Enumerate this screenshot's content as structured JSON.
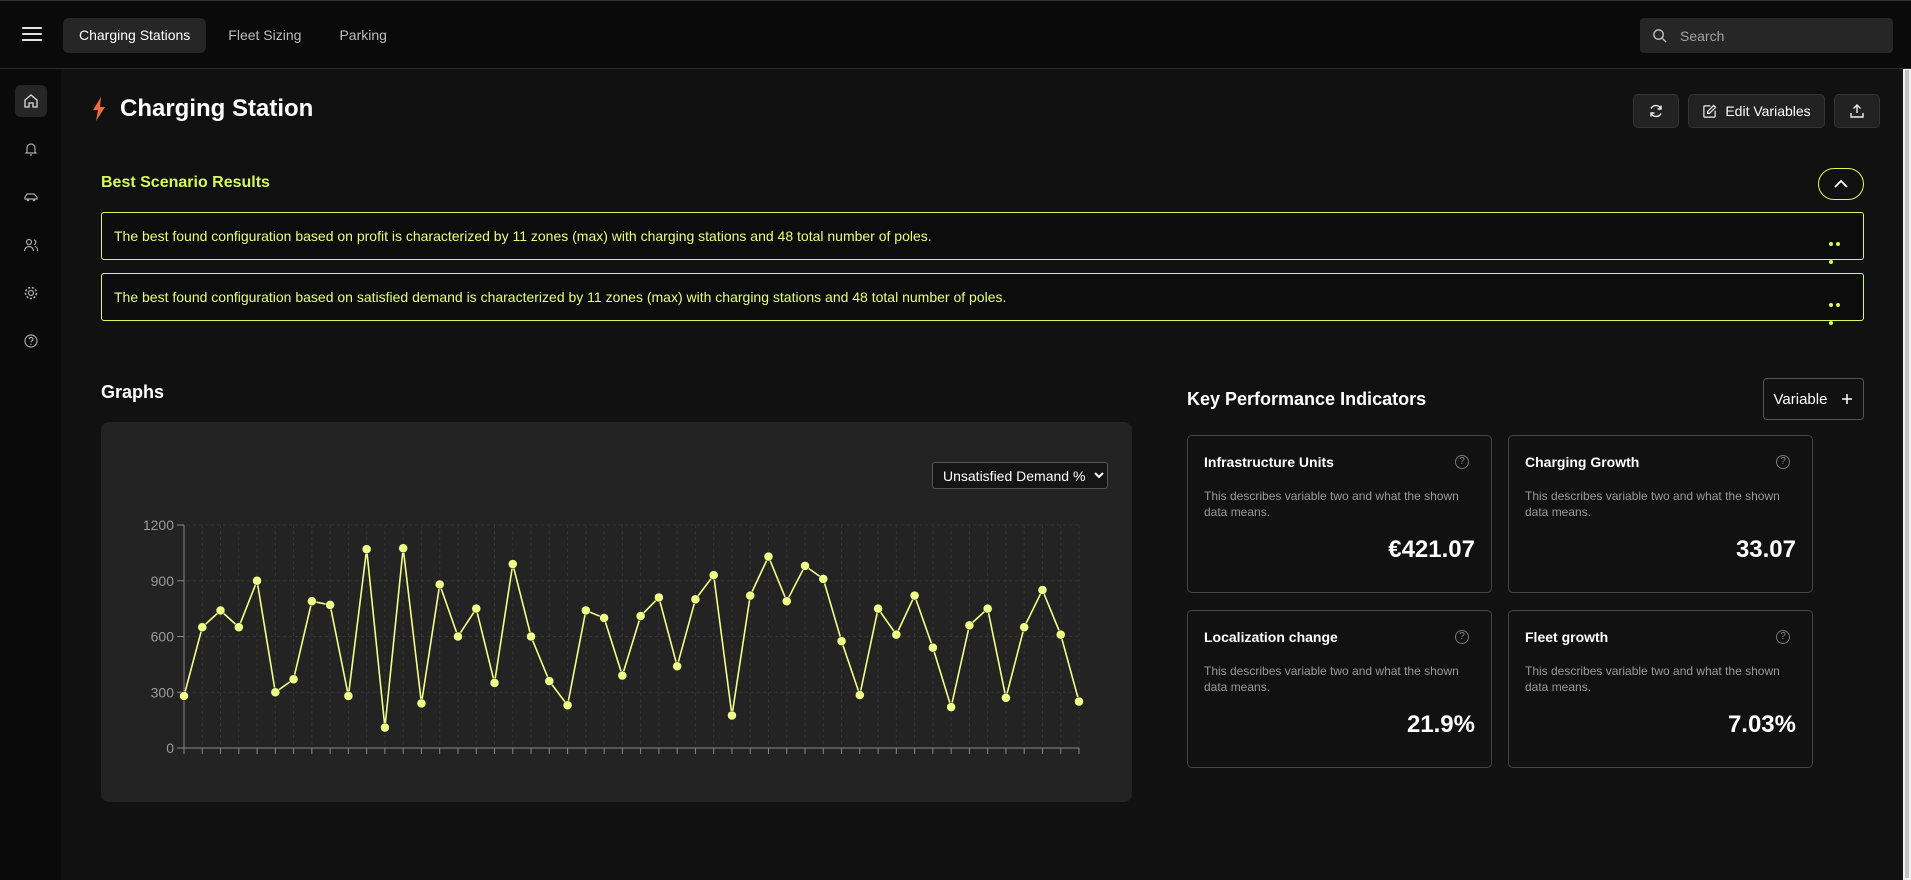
{
  "header": {
    "tabs": [
      {
        "label": "Charging Stations"
      },
      {
        "label": "Fleet Sizing"
      },
      {
        "label": "Parking"
      }
    ],
    "search_placeholder": "Search"
  },
  "sidebar": {
    "items": [
      "home-icon",
      "bell-icon",
      "car-icon",
      "users-icon",
      "gear-icon",
      "help-icon"
    ]
  },
  "page": {
    "title": "Charging Station",
    "edit_variables_label": "Edit Variables"
  },
  "best_results": {
    "title": "Best Scenario Results",
    "items": [
      "The best found configuration based on profit is characterized by 11 zones (max) with charging stations and 48 total number of poles.",
      "The best found configuration based on satisfied demand is characterized by 11 zones (max) with charging stations and 48 total number of poles."
    ]
  },
  "graphs": {
    "title": "Graphs",
    "selected_metric": "Unsatisfied Demand %"
  },
  "kpi": {
    "title": "Key Performance Indicators",
    "variable_button": "Variable",
    "cards": [
      {
        "name": "Infrastructure Units",
        "description": "This describes variable two and what the shown data means.",
        "value": "€421.07"
      },
      {
        "name": "Charging Growth",
        "description": "This describes variable two and what the shown data means.",
        "value": "33.07"
      },
      {
        "name": "Localization change",
        "description": "This describes variable two and what the shown data means.",
        "value": "21.9%"
      },
      {
        "name": "Fleet growth",
        "description": "This describes variable two and what the shown data means.",
        "value": "7.03%"
      }
    ]
  },
  "colors": {
    "accent": "#d4fa5e",
    "line": "#f0ff8a"
  },
  "chart_data": {
    "type": "line",
    "title": "",
    "xlabel": "",
    "ylabel": "",
    "ylim": [
      0,
      1200
    ],
    "yticks": [
      0,
      300,
      600,
      900,
      1200
    ],
    "grid": true,
    "values": [
      280,
      650,
      740,
      650,
      900,
      300,
      370,
      790,
      770,
      280,
      1070,
      110,
      1075,
      240,
      880,
      600,
      750,
      350,
      990,
      600,
      360,
      230,
      740,
      700,
      390,
      710,
      810,
      440,
      800,
      930,
      175,
      820,
      1030,
      790,
      980,
      910,
      575,
      285,
      750,
      610,
      820,
      540,
      220,
      660,
      750,
      270,
      650,
      850,
      610,
      250
    ]
  }
}
